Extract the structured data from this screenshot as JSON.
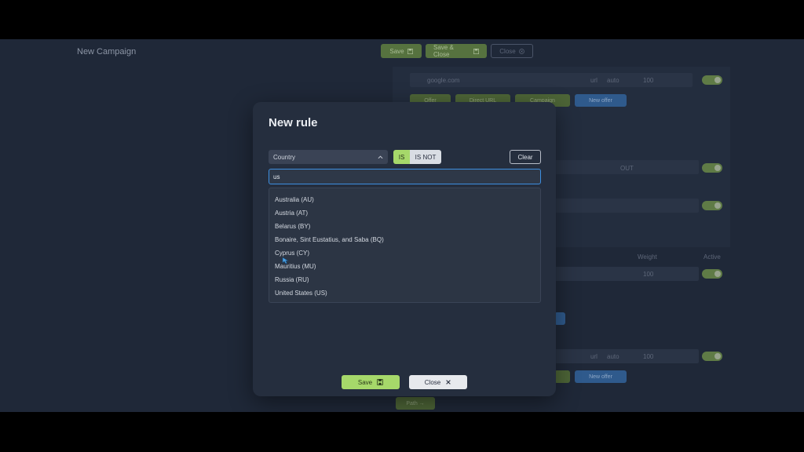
{
  "background": {
    "title": "New Campaign",
    "save_label": "Save",
    "save_close_label": "Save & Close",
    "close_label": "Close",
    "path_url": "google.com",
    "url_tag": "url",
    "auto_tag": "auto",
    "weight_value": "100",
    "offer_btn": "Offer",
    "direct_url_btn": "Direct URL",
    "campaign_btn": "Campaign",
    "new_offer_btn": "New offer",
    "out_label": "OUT",
    "weight_header": "Weight",
    "active_header": "Active",
    "path_btn": "Path"
  },
  "modal": {
    "title": "New rule",
    "field_select": "Country",
    "is_label": "IS",
    "is_not_label": "IS NOT",
    "clear_label": "Clear",
    "search_value": "us",
    "options": [
      "Australia (AU)",
      "Austria (AT)",
      "Belarus (BY)",
      "Bonaire, Sint Eustatius, and Saba (BQ)",
      "Cyprus (CY)",
      "Mauritius (MU)",
      "Russia (RU)",
      "United States (US)"
    ],
    "save_label": "Save",
    "close_label": "Close"
  },
  "colors": {
    "accent_green": "#a6d86a",
    "focus_blue": "#3d8ee0",
    "modal_bg": "#252e3e"
  }
}
